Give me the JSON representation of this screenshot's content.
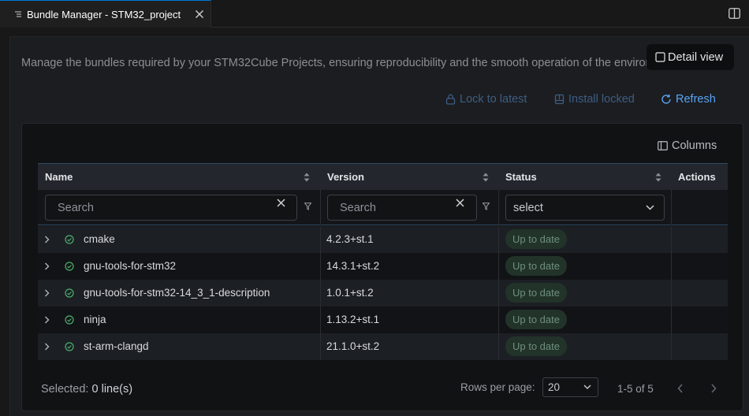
{
  "tab": {
    "title": "Bundle Manager - STM32_project"
  },
  "header": {
    "description": "Manage the bundles required by your STM32Cube Projects, ensuring reproducibility and the smooth operation of the environment.",
    "detail_view_label": "Detail view"
  },
  "actions": {
    "lock_label": "Lock to latest",
    "install_label": "Install locked",
    "refresh_label": "Refresh"
  },
  "toolbar": {
    "columns_label": "Columns"
  },
  "table": {
    "columns": {
      "name": "Name",
      "version": "Version",
      "status": "Status",
      "actions": "Actions"
    },
    "filters": {
      "name_placeholder": "Search",
      "version_placeholder": "Search",
      "status_placeholder": "select"
    },
    "rows": [
      {
        "name": "cmake",
        "version": "4.2.3+st.1",
        "status": "Up to date"
      },
      {
        "name": "gnu-tools-for-stm32",
        "version": "14.3.1+st.2",
        "status": "Up to date"
      },
      {
        "name": "gnu-tools-for-stm32-14_3_1-description",
        "version": "1.0.1+st.2",
        "status": "Up to date"
      },
      {
        "name": "ninja",
        "version": "1.13.2+st.1",
        "status": "Up to date"
      },
      {
        "name": "st-arm-clangd",
        "version": "21.1.0+st.2",
        "status": "Up to date"
      }
    ]
  },
  "footer": {
    "selected_label": "Selected:",
    "selected_value": "0 line(s)",
    "rows_per_page_label": "Rows per page:",
    "rows_per_page_value": "20",
    "range": "1-5 of 5"
  },
  "colors": {
    "accent": "#5aa6f4",
    "status_ok": "#4caf6e",
    "badge_bg": "#223329"
  }
}
